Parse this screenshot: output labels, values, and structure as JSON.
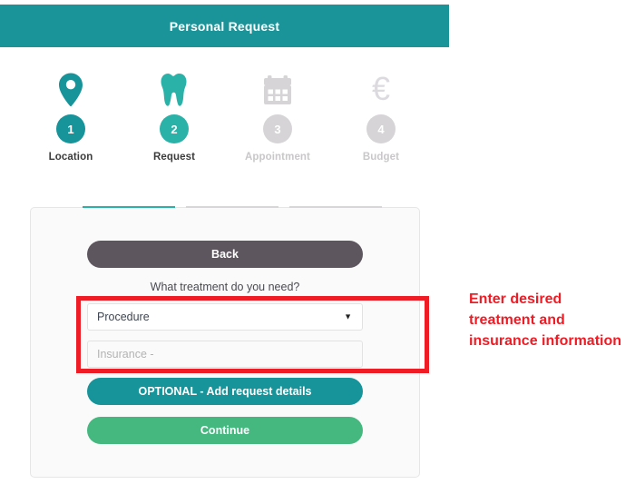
{
  "header": {
    "title": "Personal Request",
    "bg_color": "#1b9499"
  },
  "stepper": {
    "steps": [
      {
        "number": "1",
        "label": "Location",
        "icon": "map-pin-icon",
        "state": "active",
        "color": "#17939a"
      },
      {
        "number": "2",
        "label": "Request",
        "icon": "tooth-icon",
        "state": "active",
        "color": "#2bb2a8"
      },
      {
        "number": "3",
        "label": "Appointment",
        "icon": "calendar-icon",
        "state": "inactive",
        "color": "#d6d4d6"
      },
      {
        "number": "4",
        "label": "Budget",
        "icon": "euro-icon",
        "state": "inactive",
        "color": "#d6d4d6"
      }
    ]
  },
  "form": {
    "back_label": "Back",
    "question": "What treatment do you need?",
    "procedure_select": {
      "value": "Procedure",
      "caret": "▼"
    },
    "insurance_input": {
      "value": "",
      "placeholder": "Insurance  -"
    },
    "optional_label": "OPTIONAL - Add request details",
    "continue_label": "Continue"
  },
  "annotation": {
    "text": "Enter desired treatment and insurance information",
    "color": "#ef1c25"
  }
}
